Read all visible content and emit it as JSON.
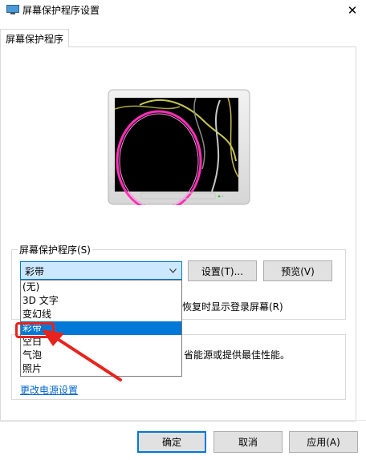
{
  "window": {
    "title": "屏幕保护程序设置",
    "close_glyph": "✕"
  },
  "tab": {
    "label": "屏幕保护程序"
  },
  "screensaver": {
    "group_label": "屏幕保护程序(S)",
    "selected": "彩带",
    "settings_button": "设置(T)...",
    "preview_button": "预览(V)",
    "options": [
      "(无)",
      "3D 文字",
      "变幻线",
      "彩带",
      "空白",
      "气泡",
      "照片"
    ],
    "selected_index": 3,
    "resume_text_partial": "恢复时显示登录屏幕(R)"
  },
  "power": {
    "text_partial": "省能源或提供最佳性能。",
    "link": "更改电源设置"
  },
  "footer": {
    "ok": "确定",
    "cancel": "取消",
    "apply": "应用(A)"
  },
  "colors": {
    "accent": "#0078d7",
    "highlight_box": "#e8231d",
    "arrow": "#e8231d"
  }
}
